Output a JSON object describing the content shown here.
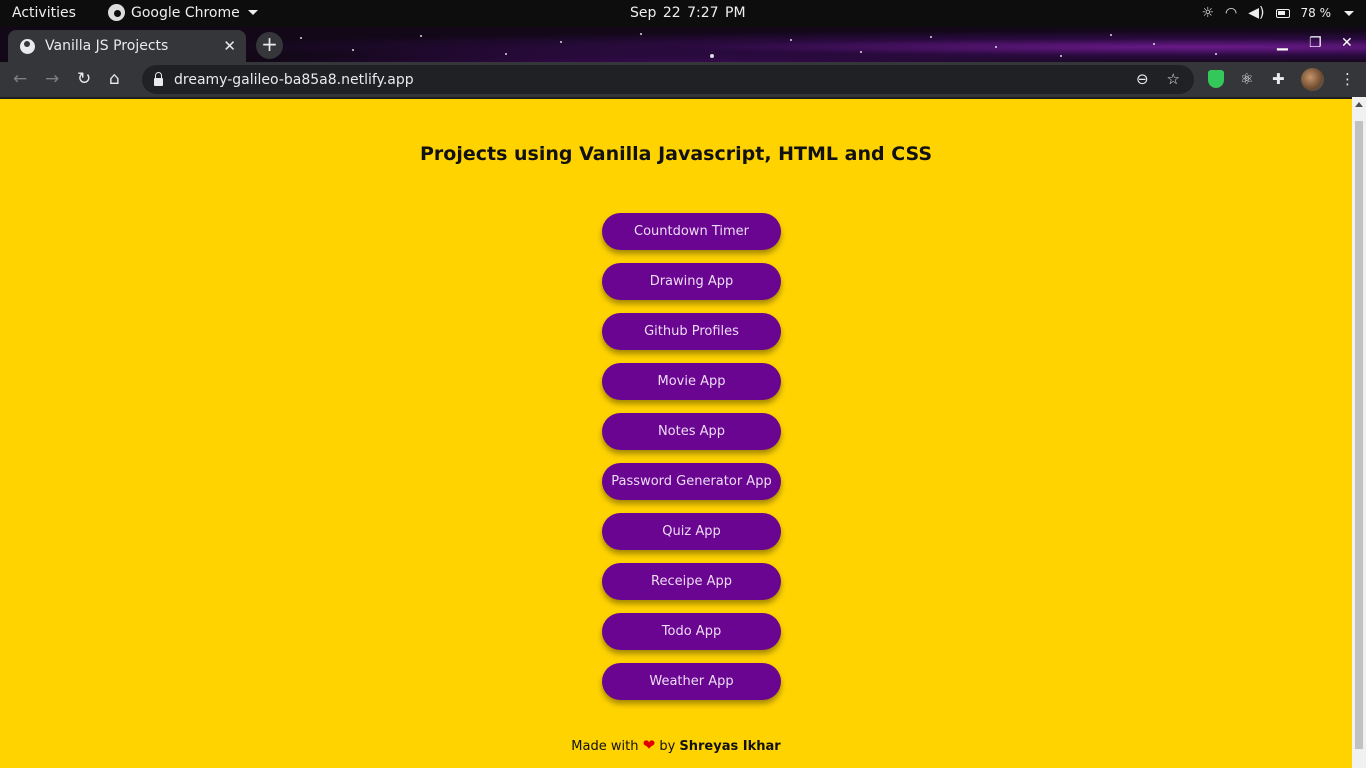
{
  "os_bar": {
    "activities": "Activities",
    "app_name": "Google Chrome",
    "date": "Sep 22",
    "time": "7:27 PM",
    "battery": "78 %"
  },
  "browser": {
    "tab_title": "Vanilla JS Projects",
    "url": "dreamy-galileo-ba85a8.netlify.app"
  },
  "page": {
    "title": "Projects using Vanilla Javascript, HTML and CSS",
    "projects": [
      "Countdown Timer",
      "Drawing App",
      "Github Profiles",
      "Movie App",
      "Notes App",
      "Password Generator App",
      "Quiz App",
      "Receipe App",
      "Todo App",
      "Weather App"
    ],
    "footer": {
      "prefix": "Made with",
      "heart": "❤",
      "by": "by",
      "author": "Shreyas Ikhar"
    }
  },
  "colors": {
    "page_background": "#ffd300",
    "button_background": "#6a0591",
    "button_text": "#eddcf5",
    "heart": "#e00000"
  }
}
